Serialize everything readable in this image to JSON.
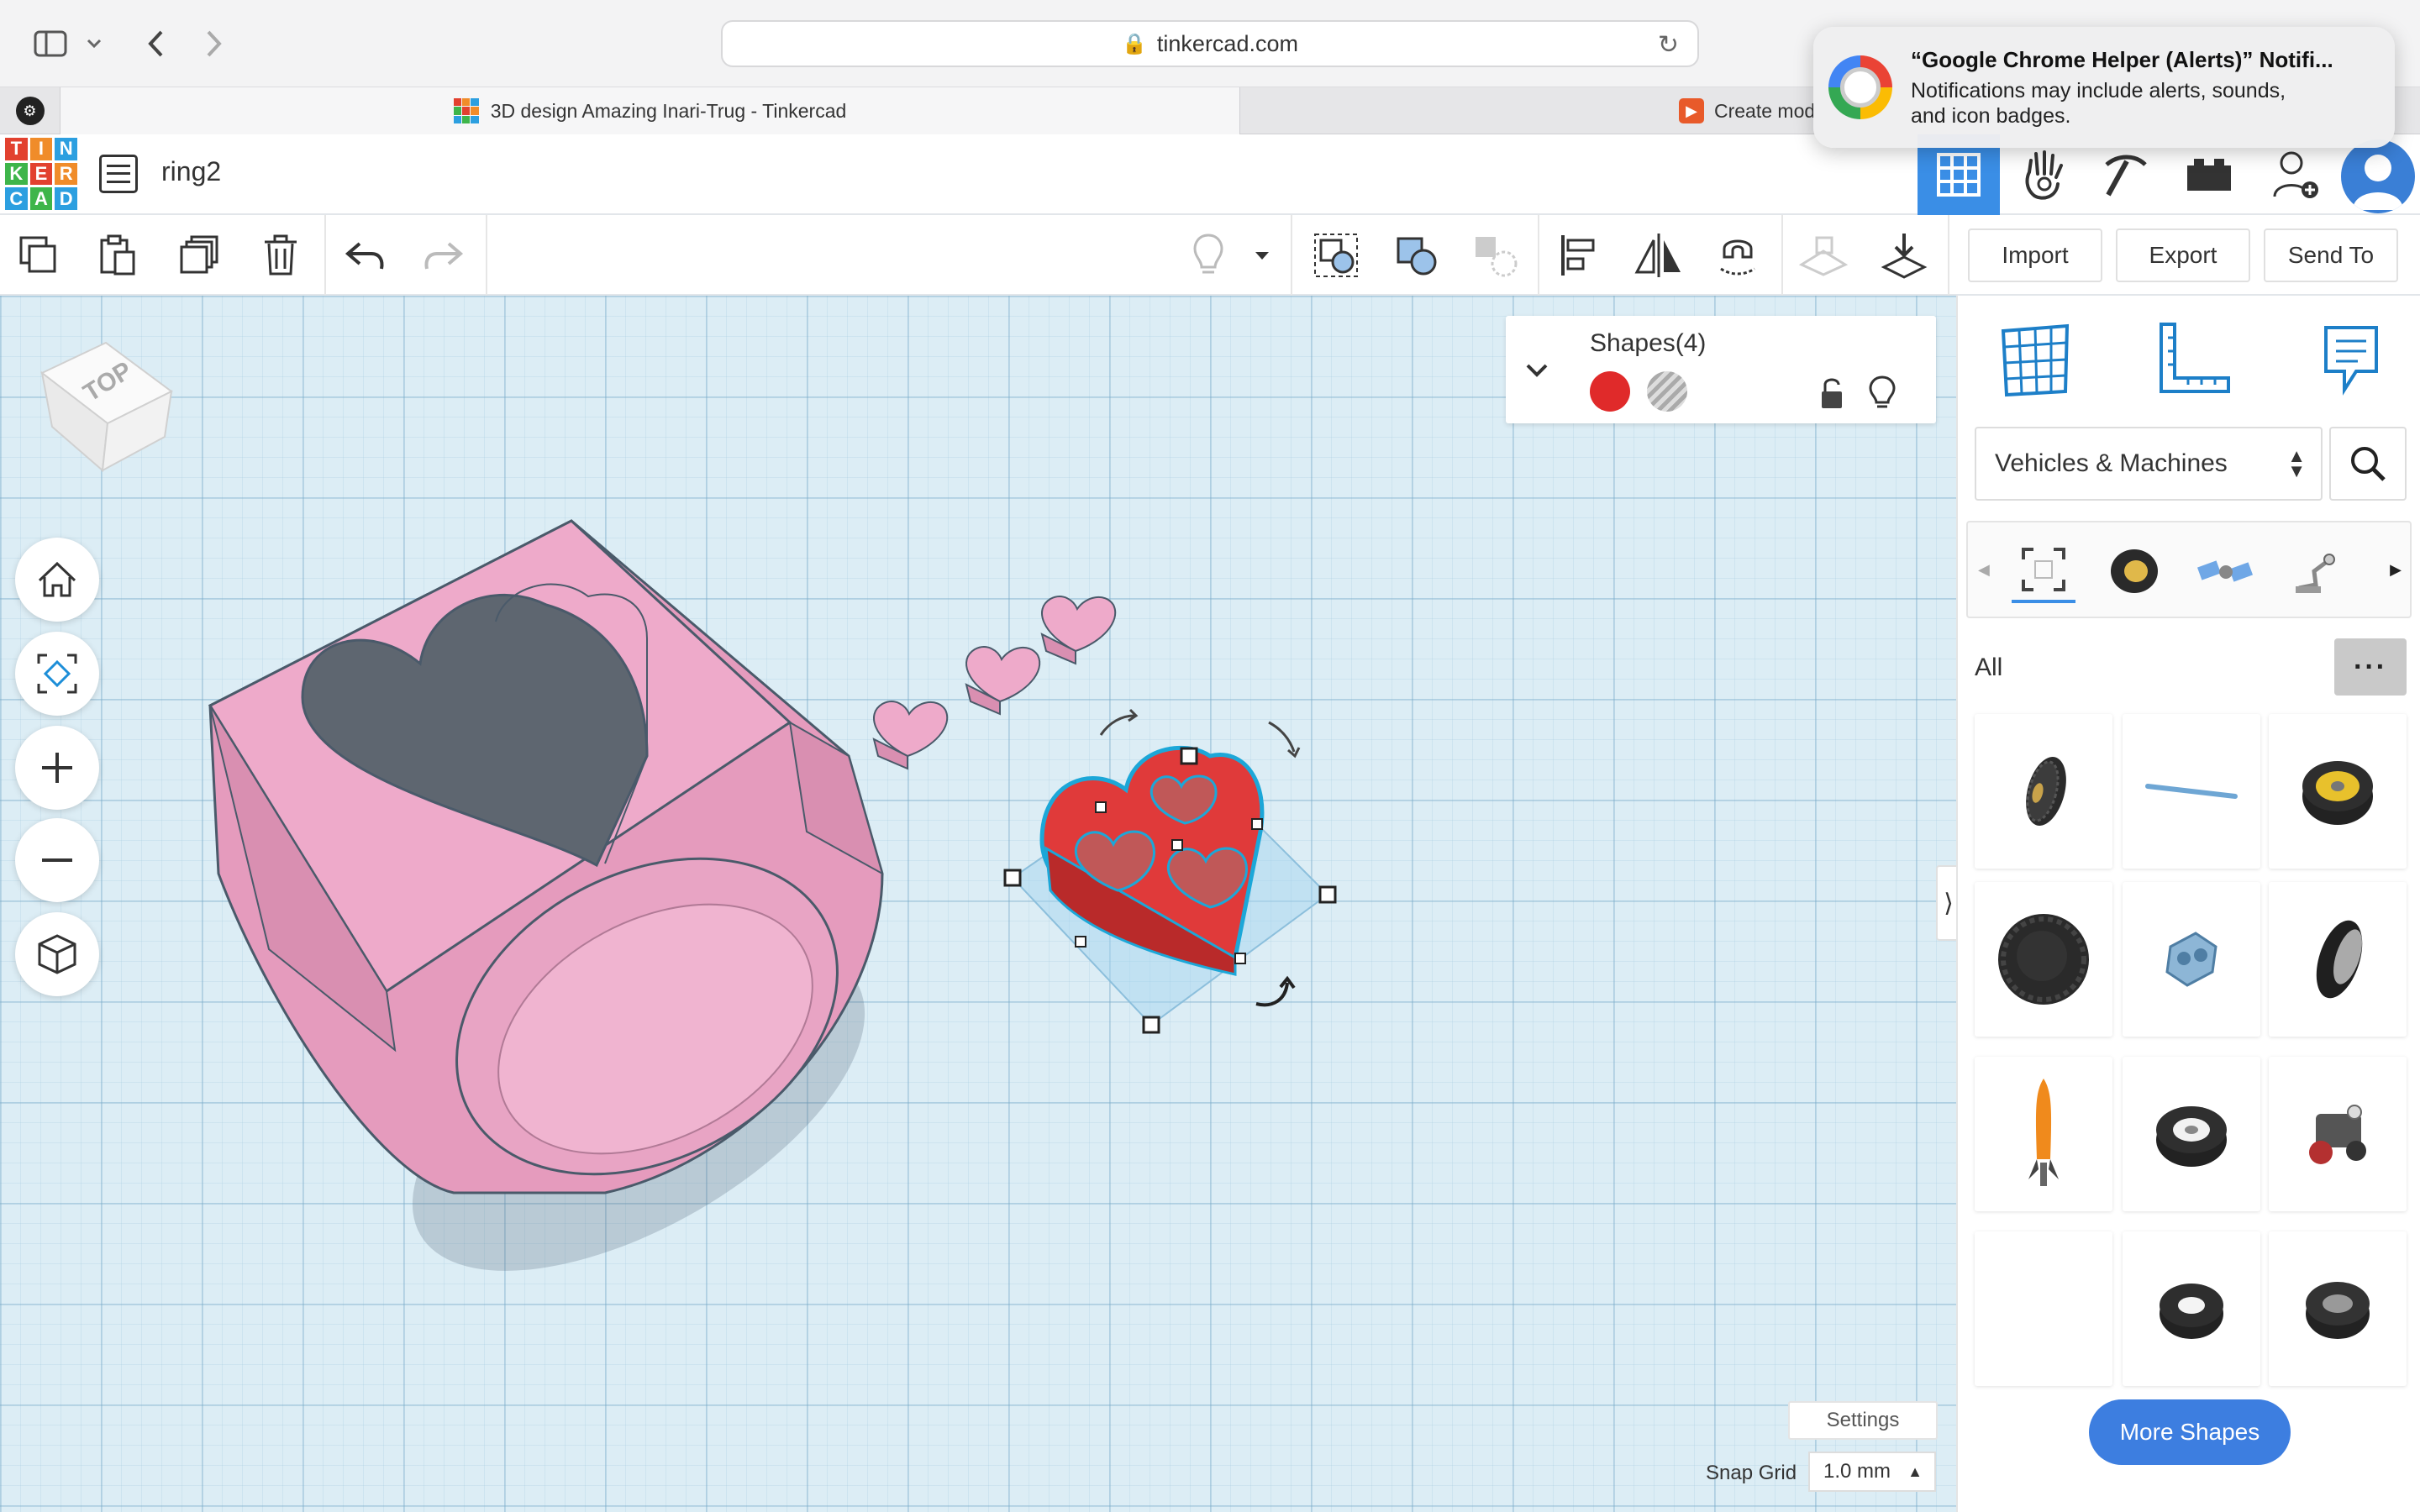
{
  "browser": {
    "url": "tinkercad.com",
    "tabs": [
      {
        "title": "3D design Amazing Inari-Trug - Tinkercad"
      },
      {
        "title": "Create mod"
      }
    ]
  },
  "notification": {
    "title": "“Google Chrome Helper (Alerts)” Notifi...",
    "line1": "Notifications may include alerts, sounds,",
    "line2": "and icon badges."
  },
  "app": {
    "logo_letters": [
      "T",
      "I",
      "N",
      "K",
      "E",
      "R",
      "C",
      "A",
      "D"
    ],
    "logo_colors": [
      "#e2412f",
      "#f08c2a",
      "#2c9fe0",
      "#3eb54a",
      "#e2412f",
      "#f08c2a",
      "#2c9fe0",
      "#3eb54a",
      "#2c9fe0"
    ],
    "design_name": "ring2",
    "accent": "#3a8ee6"
  },
  "toolbar": {
    "import_label": "Import",
    "export_label": "Export",
    "send_to_label": "Send To"
  },
  "shapes_panel": {
    "title": "Shapes(4)",
    "solid_color": "#e02a2a"
  },
  "workplane": {
    "view_cube_label": "TOP",
    "settings_label": "Settings",
    "snap_grid_label": "Snap Grid",
    "snap_grid_value": "1.0 mm"
  },
  "library": {
    "category": "Vehicles & Machines",
    "filter_label": "All",
    "more_label": "···",
    "more_shapes_label": "More Shapes"
  }
}
